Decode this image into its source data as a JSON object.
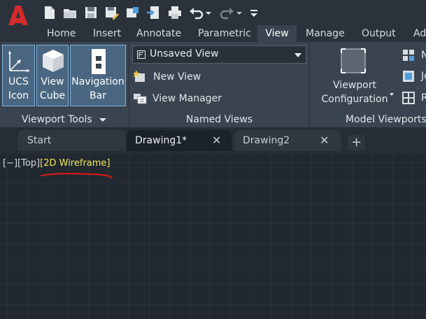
{
  "ribbon_tabs": [
    "Home",
    "Insert",
    "Annotate",
    "Parametric",
    "View",
    "Manage",
    "Output",
    "Ad"
  ],
  "active_tab": "View",
  "viewport_tools": {
    "ucs_icon": [
      "UCS",
      "Icon"
    ],
    "view_cube": [
      "View",
      "Cube"
    ],
    "navigation_bar": [
      "Navigation",
      "Bar"
    ],
    "panel_title": "Viewport Tools"
  },
  "named_views": {
    "current_view": "Unsaved View",
    "new_view": "New View",
    "view_manager": "View Manager",
    "panel_title": "Named Views"
  },
  "model_viewports": {
    "viewport_configuration": [
      "Viewport",
      "Configuration"
    ],
    "panel_title": "Model Viewports",
    "side_items": [
      "N",
      "Jo",
      "R"
    ]
  },
  "doc_tabs": {
    "start": "Start",
    "drawing1": "Drawing1*",
    "drawing2": "Drawing2",
    "close_glyph": "✕",
    "add_glyph": "+"
  },
  "viewport_label": {
    "controls": "[−]",
    "view": "[Top]",
    "visual_style": "[2D Wireframe]"
  },
  "colors": {
    "logo_red": "#d42b2b",
    "highlight_yellow": "#f1e65b",
    "annotation_red": "#e01818",
    "selected_button": "#4a6680"
  }
}
